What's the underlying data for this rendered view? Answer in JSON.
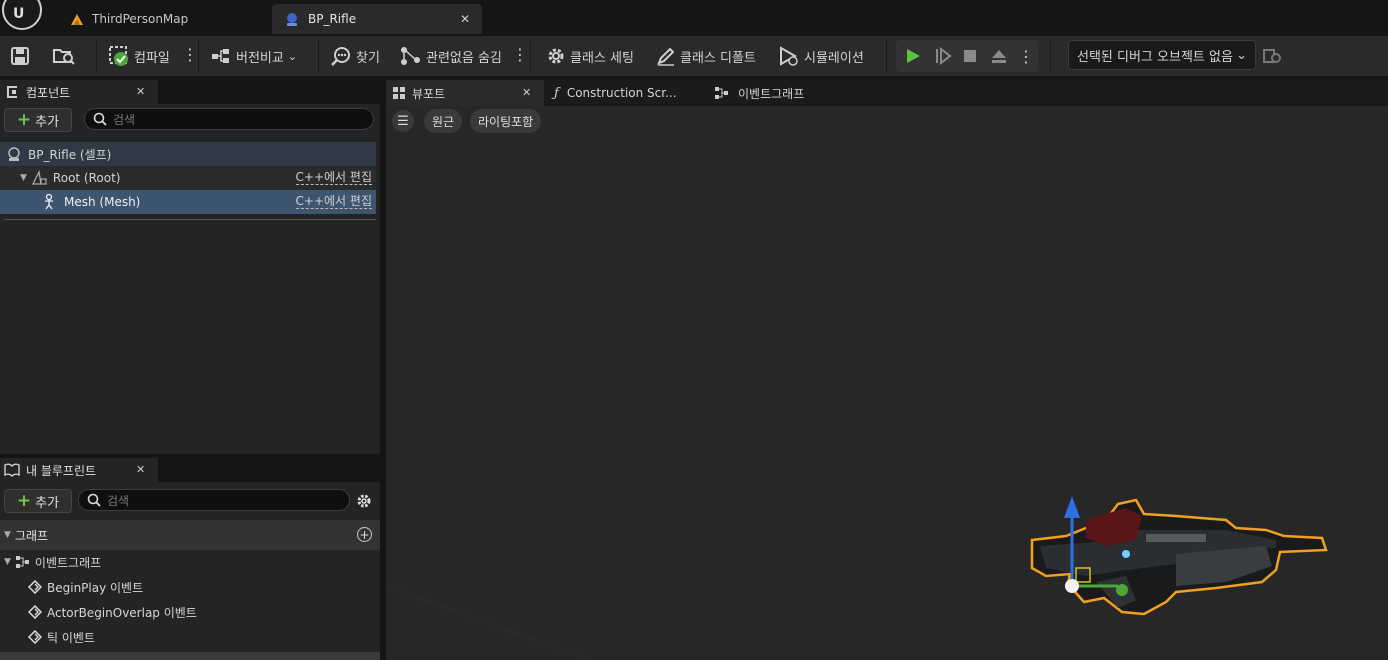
{
  "tabs": [
    {
      "label": "ThirdPersonMap"
    },
    {
      "label": "BP_Rifle"
    }
  ],
  "toolbar": {
    "compile": "컴파일",
    "diff": "버전비교",
    "find": "찾기",
    "hide_unrelated": "관련없음 숨김",
    "class_settings": "클래스 세팅",
    "class_defaults": "클래스 디폴트",
    "simulation": "시뮬레이션",
    "debug_object": "선택된 디버그 오브젝트 없음"
  },
  "components": {
    "tab_label": "컴포넌트",
    "add_label": "추가",
    "search_placeholder": "검색",
    "items": [
      {
        "label": "BP_Rifle (셀프)",
        "edit": ""
      },
      {
        "label": "Root (Root)",
        "edit": "C++에서 편집"
      },
      {
        "label": "Mesh (Mesh)",
        "edit": "C++에서 편집"
      }
    ]
  },
  "my_blueprint": {
    "tab_label": "내 블루프린트",
    "add_label": "추가",
    "search_placeholder": "검색",
    "graph_section": "그래프",
    "event_graph": "이벤트그래프",
    "events": [
      {
        "label": "BeginPlay 이벤트"
      },
      {
        "label": "ActorBeginOverlap 이벤트"
      },
      {
        "label": "틱 이벤트"
      }
    ]
  },
  "viewport_tabs": [
    {
      "label": "뷰포트"
    },
    {
      "label": "Construction Scr..."
    },
    {
      "label": "이벤트그래프"
    }
  ],
  "viewport": {
    "perspective": "원근",
    "lit": "라이팅포함"
  },
  "colors": {
    "accent_green": "#5cc43a",
    "selection_blue": "#3d556e",
    "outline_orange": "#f0a020"
  }
}
